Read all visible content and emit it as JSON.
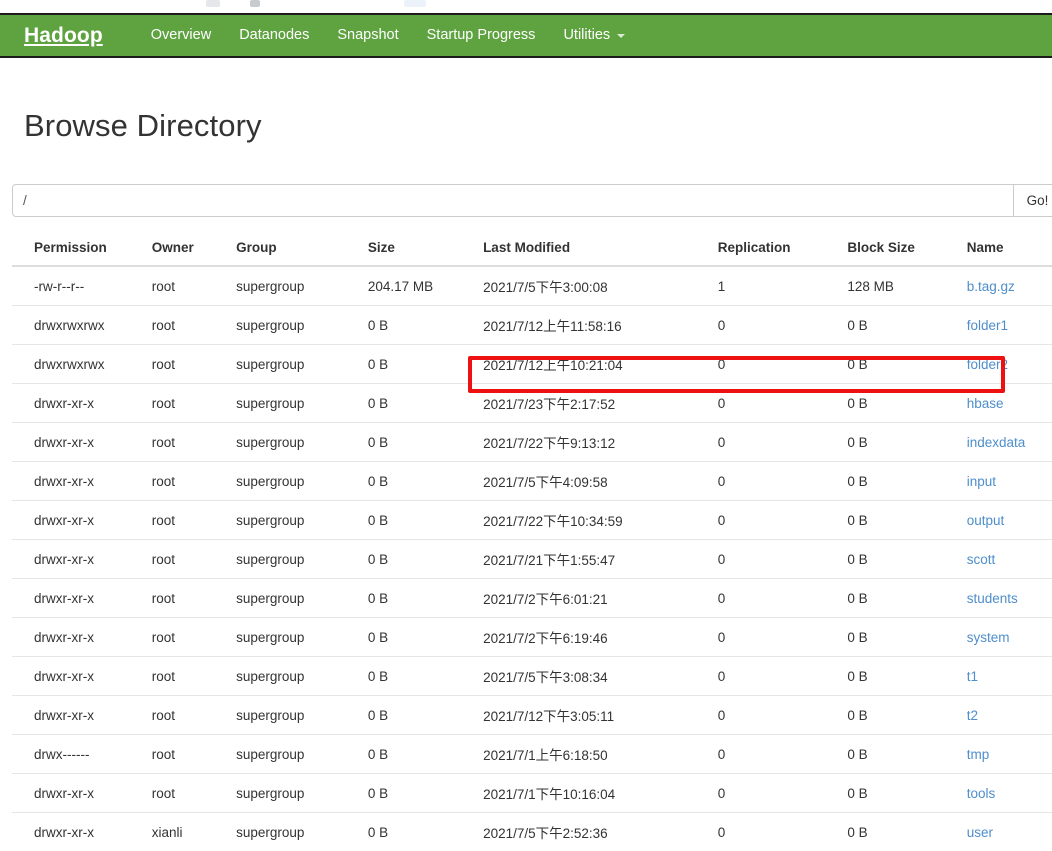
{
  "navbar": {
    "brand": "Hadoop",
    "items": [
      {
        "label": "Overview",
        "name": "nav-overview"
      },
      {
        "label": "Datanodes",
        "name": "nav-datanodes"
      },
      {
        "label": "Snapshot",
        "name": "nav-snapshot"
      },
      {
        "label": "Startup Progress",
        "name": "nav-startup-progress"
      },
      {
        "label": "Utilities",
        "name": "nav-utilities",
        "dropdown": true
      }
    ],
    "background_color": "#5fa341"
  },
  "page": {
    "title": "Browse Directory"
  },
  "path_form": {
    "value": "/",
    "placeholder": "",
    "go_label": "Go!"
  },
  "table": {
    "headers": [
      "Permission",
      "Owner",
      "Group",
      "Size",
      "Last Modified",
      "Replication",
      "Block Size",
      "Name"
    ],
    "rows": [
      {
        "permission": "-rw-r--r--",
        "owner": "root",
        "group": "supergroup",
        "size": "204.17 MB",
        "last_modified": "2021/7/5下午3:00:08",
        "replication": "1",
        "block_size": "128 MB",
        "name": "b.tag.gz"
      },
      {
        "permission": "drwxrwxrwx",
        "owner": "root",
        "group": "supergroup",
        "size": "0 B",
        "last_modified": "2021/7/12上午11:58:16",
        "replication": "0",
        "block_size": "0 B",
        "name": "folder1"
      },
      {
        "permission": "drwxrwxrwx",
        "owner": "root",
        "group": "supergroup",
        "size": "0 B",
        "last_modified": "2021/7/12上午10:21:04",
        "replication": "0",
        "block_size": "0 B",
        "name": "folder2"
      },
      {
        "permission": "drwxr-xr-x",
        "owner": "root",
        "group": "supergroup",
        "size": "0 B",
        "last_modified": "2021/7/23下午2:17:52",
        "replication": "0",
        "block_size": "0 B",
        "name": "hbase"
      },
      {
        "permission": "drwxr-xr-x",
        "owner": "root",
        "group": "supergroup",
        "size": "0 B",
        "last_modified": "2021/7/22下午9:13:12",
        "replication": "0",
        "block_size": "0 B",
        "name": "indexdata"
      },
      {
        "permission": "drwxr-xr-x",
        "owner": "root",
        "group": "supergroup",
        "size": "0 B",
        "last_modified": "2021/7/5下午4:09:58",
        "replication": "0",
        "block_size": "0 B",
        "name": "input"
      },
      {
        "permission": "drwxr-xr-x",
        "owner": "root",
        "group": "supergroup",
        "size": "0 B",
        "last_modified": "2021/7/22下午10:34:59",
        "replication": "0",
        "block_size": "0 B",
        "name": "output"
      },
      {
        "permission": "drwxr-xr-x",
        "owner": "root",
        "group": "supergroup",
        "size": "0 B",
        "last_modified": "2021/7/21下午1:55:47",
        "replication": "0",
        "block_size": "0 B",
        "name": "scott"
      },
      {
        "permission": "drwxr-xr-x",
        "owner": "root",
        "group": "supergroup",
        "size": "0 B",
        "last_modified": "2021/7/2下午6:01:21",
        "replication": "0",
        "block_size": "0 B",
        "name": "students"
      },
      {
        "permission": "drwxr-xr-x",
        "owner": "root",
        "group": "supergroup",
        "size": "0 B",
        "last_modified": "2021/7/2下午6:19:46",
        "replication": "0",
        "block_size": "0 B",
        "name": "system"
      },
      {
        "permission": "drwxr-xr-x",
        "owner": "root",
        "group": "supergroup",
        "size": "0 B",
        "last_modified": "2021/7/5下午3:08:34",
        "replication": "0",
        "block_size": "0 B",
        "name": "t1"
      },
      {
        "permission": "drwxr-xr-x",
        "owner": "root",
        "group": "supergroup",
        "size": "0 B",
        "last_modified": "2021/7/12下午3:05:11",
        "replication": "0",
        "block_size": "0 B",
        "name": "t2"
      },
      {
        "permission": "drwx------",
        "owner": "root",
        "group": "supergroup",
        "size": "0 B",
        "last_modified": "2021/7/1上午6:18:50",
        "replication": "0",
        "block_size": "0 B",
        "name": "tmp"
      },
      {
        "permission": "drwxr-xr-x",
        "owner": "root",
        "group": "supergroup",
        "size": "0 B",
        "last_modified": "2021/7/1下午10:16:04",
        "replication": "0",
        "block_size": "0 B",
        "name": "tools"
      },
      {
        "permission": "drwxr-xr-x",
        "owner": "xianli",
        "group": "supergroup",
        "size": "0 B",
        "last_modified": "2021/7/5下午2:52:36",
        "replication": "0",
        "block_size": "0 B",
        "name": "user"
      }
    ]
  },
  "annotation": {
    "highlight_row_name": "hbase",
    "color": "#ee1111"
  }
}
